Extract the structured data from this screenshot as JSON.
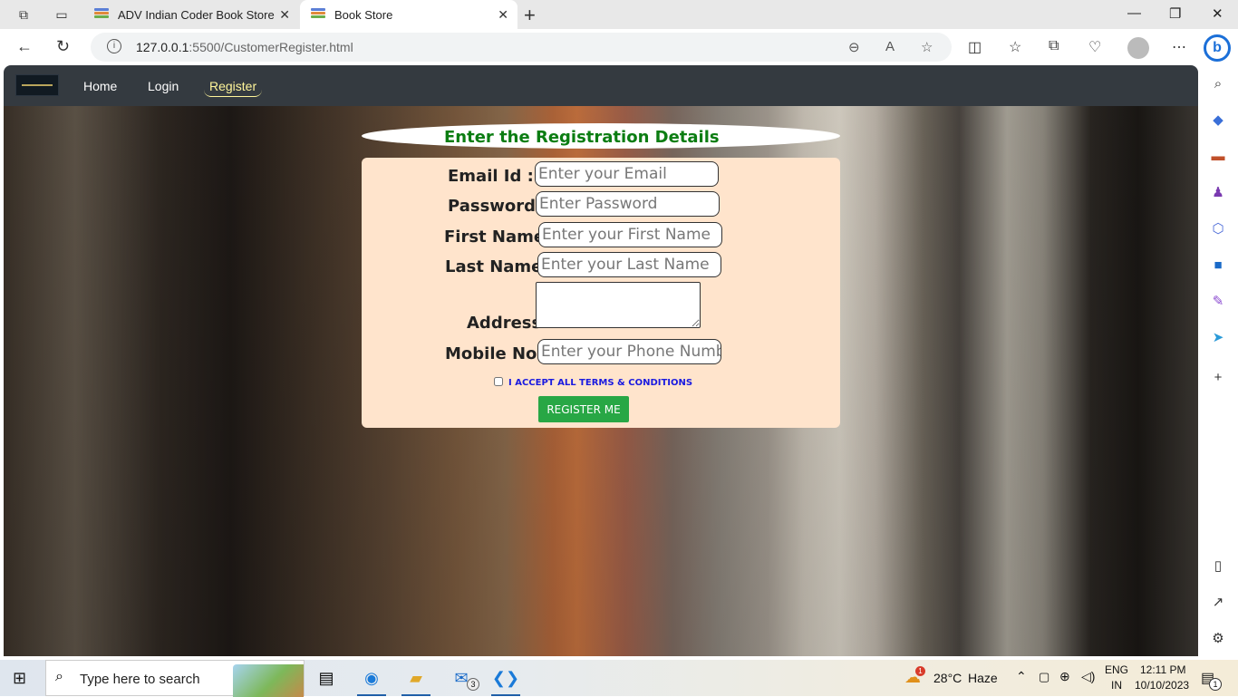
{
  "browser": {
    "tabs": [
      {
        "title": "ADV Indian Coder Book Store",
        "active": false
      },
      {
        "title": "Book Store",
        "active": true
      }
    ],
    "url": {
      "host": "127.0.0.1",
      "rest": ":5500/CustomerRegister.html"
    },
    "new_tab_glyph": "+",
    "window_controls": {
      "minimize": "—",
      "maximize": "❐",
      "close": "✕"
    }
  },
  "site": {
    "nav": {
      "home": "Home",
      "login": "Login",
      "register": "Register"
    },
    "form": {
      "title": "Enter the Registration Details",
      "email_label": "Email Id :",
      "email_placeholder": "Enter your Email",
      "password_label": "Password :",
      "password_placeholder": "Enter Password",
      "first_name_label": "First Name :",
      "first_name_placeholder": "Enter your First Name",
      "last_name_label": "Last Name :",
      "last_name_placeholder": "Enter your Last Name",
      "address_label": "Address:",
      "mobile_label": "Mobile No :",
      "mobile_placeholder": "Enter your Phone Number",
      "terms_text": "I ACCEPT ALL TERMS & CONDITIONS",
      "submit_label": "REGISTER ME"
    }
  },
  "taskbar": {
    "search_placeholder": "Type here to search",
    "weather": {
      "temp": "28°C",
      "condition": "Haze",
      "badge": "1"
    },
    "language": {
      "line1": "ENG",
      "line2": "IN"
    },
    "time": "12:11 PM",
    "date": "10/10/2023",
    "mail_badge": "3",
    "notification_badge": "1"
  },
  "colors": {
    "navbar": "#343a40",
    "form_bg": "#ffe4cc",
    "title_green": "#0b7d12",
    "button_green": "#28a745",
    "terms_blue": "#1a1ae0",
    "active_link": "#fff59a"
  }
}
